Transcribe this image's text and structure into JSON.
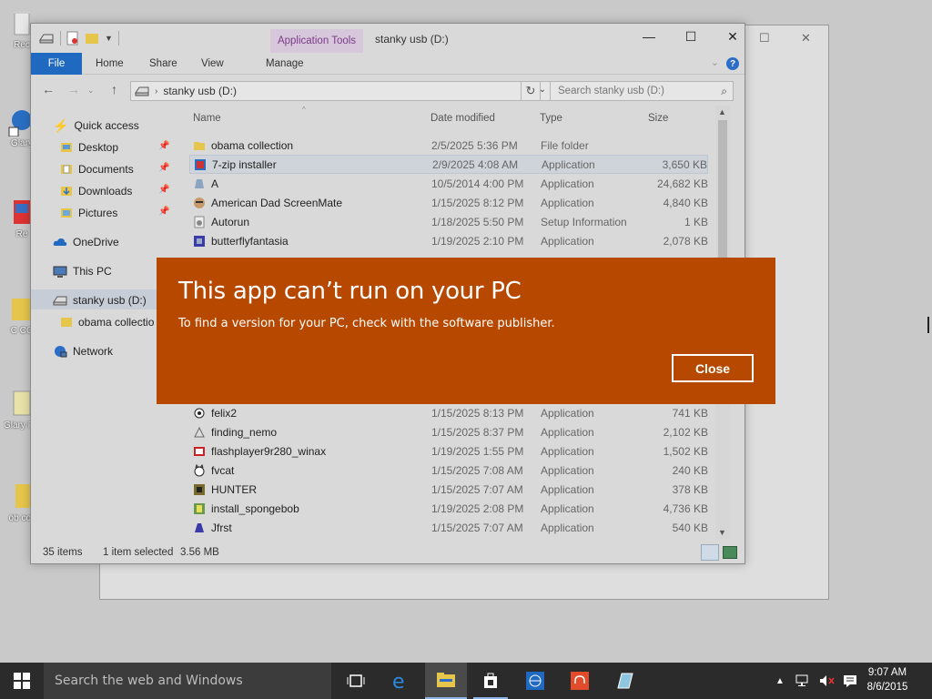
{
  "desktop": {
    "icons": [
      {
        "label": "Rec",
        "icon": "recycle-bin-icon"
      },
      {
        "label": "Glary",
        "icon": "glary-shortcut-icon"
      },
      {
        "label": "Re",
        "icon": "re-shortcut-icon"
      },
      {
        "label": "C CC",
        "icon": "ccleaner-icon"
      },
      {
        "label": "Glary Pro",
        "icon": "glary-pro-icon"
      },
      {
        "label": "ob coll",
        "icon": "folder-icon"
      }
    ]
  },
  "window": {
    "title": "stanky usb (D:)",
    "context_tab": "Application Tools",
    "tabs": [
      "File",
      "Home",
      "Share",
      "View",
      "Manage"
    ],
    "address": {
      "path": "stanky usb (D:)"
    },
    "search": {
      "placeholder": "Search stanky usb (D:)"
    }
  },
  "navpane": {
    "items": [
      {
        "label": "Quick access",
        "icon": "star-icon",
        "pinned": false
      },
      {
        "label": "Desktop",
        "icon": "desktop-folder-icon",
        "pinned": true
      },
      {
        "label": "Documents",
        "icon": "documents-folder-icon",
        "pinned": true
      },
      {
        "label": "Downloads",
        "icon": "downloads-folder-icon",
        "pinned": true
      },
      {
        "label": "Pictures",
        "icon": "pictures-folder-icon",
        "pinned": true
      },
      {
        "label": "OneDrive",
        "icon": "cloud-icon",
        "pinned": false
      },
      {
        "label": "This PC",
        "icon": "computer-icon",
        "pinned": false
      },
      {
        "label": "stanky usb (D:)",
        "icon": "usb-drive-icon",
        "pinned": false
      },
      {
        "label": "obama collectio",
        "icon": "folder-icon",
        "pinned": false
      },
      {
        "label": "Network",
        "icon": "network-icon",
        "pinned": false
      }
    ]
  },
  "files": {
    "columns": [
      "Name",
      "Date modified",
      "Type",
      "Size"
    ],
    "rows": [
      {
        "name": "obama collection",
        "date": "2/5/2025 5:36 PM",
        "type": "File folder",
        "size": ""
      },
      {
        "name": "7-zip installer",
        "date": "2/9/2025 4:08 AM",
        "type": "Application",
        "size": "3,650 KB"
      },
      {
        "name": "A",
        "date": "10/5/2014 4:00 PM",
        "type": "Application",
        "size": "24,682 KB"
      },
      {
        "name": "American Dad ScreenMate",
        "date": "1/15/2025 8:12 PM",
        "type": "Application",
        "size": "4,840 KB"
      },
      {
        "name": "Autorun",
        "date": "1/18/2025 5:50 PM",
        "type": "Setup Information",
        "size": "1 KB"
      },
      {
        "name": "butterflyfantasia",
        "date": "1/19/2025 2:10 PM",
        "type": "Application",
        "size": "2,078 KB"
      },
      {
        "name": "felix2",
        "date": "1/15/2025 8:13 PM",
        "type": "Application",
        "size": "741 KB"
      },
      {
        "name": "finding_nemo",
        "date": "1/15/2025 8:37 PM",
        "type": "Application",
        "size": "2,102 KB"
      },
      {
        "name": "flashplayer9r280_winax",
        "date": "1/19/2025 1:55 PM",
        "type": "Application",
        "size": "1,502 KB"
      },
      {
        "name": "fvcat",
        "date": "1/15/2025 7:08 AM",
        "type": "Application",
        "size": "240 KB"
      },
      {
        "name": "HUNTER",
        "date": "1/15/2025 7:07 AM",
        "type": "Application",
        "size": "378 KB"
      },
      {
        "name": "install_spongebob",
        "date": "1/19/2025 2:08 PM",
        "type": "Application",
        "size": "4,736 KB"
      },
      {
        "name": "Jfrst",
        "date": "1/15/2025 7:07 AM",
        "type": "Application",
        "size": "540 KB"
      }
    ],
    "selected_index": 1
  },
  "status": {
    "count": "35 items",
    "selection": "1 item selected",
    "size": "3.56 MB"
  },
  "dialog": {
    "title": "This app can’t run on your PC",
    "message": "To find a version for your PC, check with the software publisher.",
    "close_label": "Close",
    "color": "#b74800"
  },
  "taskbar": {
    "search_placeholder": "Search the web and Windows",
    "time": "9:07 AM",
    "date": "8/6/2015"
  }
}
